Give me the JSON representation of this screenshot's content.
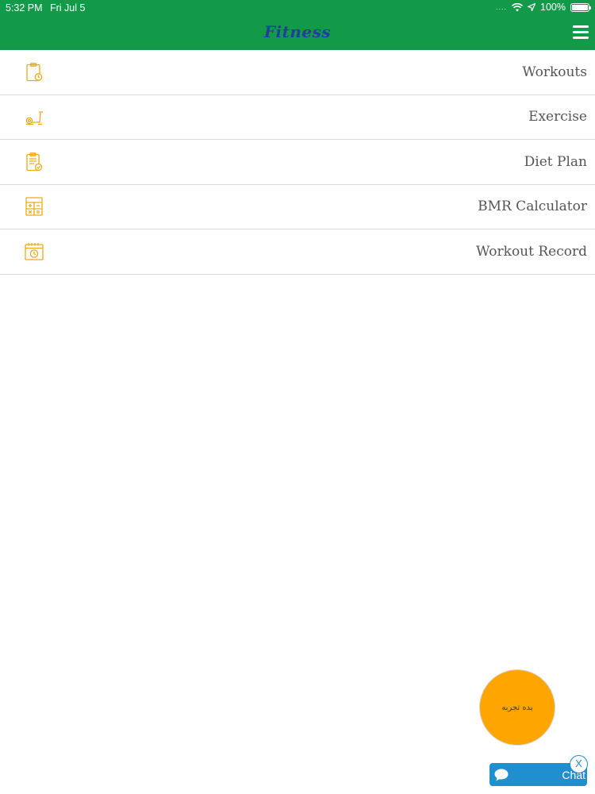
{
  "status_bar": {
    "time": "5:32 PM",
    "date": "Fri Jul 5",
    "signal_dots": "....",
    "battery_text": "100%",
    "battery_level": 1.0
  },
  "header": {
    "title": "Fitness",
    "menu_icon": "hamburger-menu-icon"
  },
  "menu": {
    "items": [
      {
        "label": "Workouts",
        "icon": "clipboard-stopwatch-icon"
      },
      {
        "label": "Exercise",
        "icon": "exercise-bike-icon"
      },
      {
        "label": "Diet Plan",
        "icon": "clipboard-check-icon"
      },
      {
        "label": "BMR Calculator",
        "icon": "calculator-icon"
      },
      {
        "label": "Workout Record",
        "icon": "calendar-clock-icon"
      }
    ]
  },
  "fab": {
    "label": "بده تجربه"
  },
  "chat": {
    "label": "Chat",
    "close_label": "X"
  },
  "colors": {
    "header_bg": "#129a48",
    "title": "#1f3ea0",
    "icon": "#f0a81c",
    "fab": "#ffa500",
    "chat": "#1f8fd0"
  }
}
